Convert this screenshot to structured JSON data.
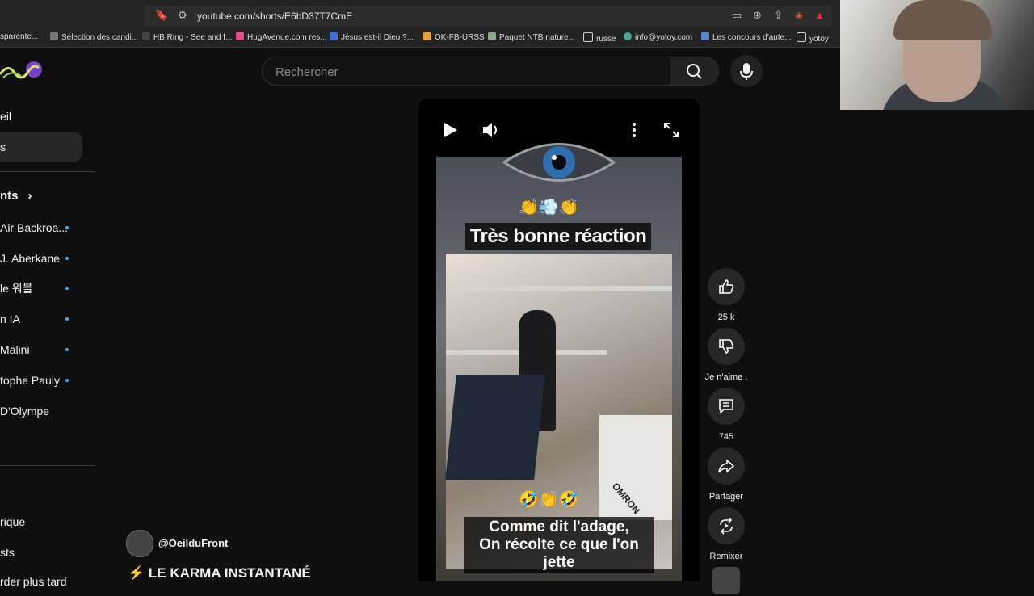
{
  "browser": {
    "url": "youtube.com/shorts/E6bD37T7CmE",
    "bookmarks": [
      "sparente...",
      "Sélection des candi...",
      "HB Ring - See and f...",
      "HugAvenue.com res...",
      "Jésus est-il Dieu ?...",
      "OK-FB-URSS",
      "Paquet NTB nature...",
      "russe",
      "info@yotoy.com",
      "Les concours d'aute...",
      "yotoy"
    ]
  },
  "search": {
    "placeholder": "Rechercher"
  },
  "sidebar": {
    "items": [
      "eil",
      "s"
    ],
    "subs_heading": "nts",
    "subscriptions": [
      "Air Backroa...",
      "J. Aberkane",
      "le 워블",
      "n IA",
      "Malini",
      "tophe Pauly",
      "D'Olympe"
    ],
    "bottom": [
      "rique",
      "sts",
      "rder plus tard"
    ]
  },
  "video": {
    "caption_top": "Très bonne réaction",
    "caption_bottom_line1": "Comme dit l'adage,",
    "caption_bottom_line2": "On récolte ce que l'on jette",
    "emoji_top": "👏💨👏",
    "emoji_bottom": "🤣👏🤣",
    "brand_on_box": "OMRON"
  },
  "actions": {
    "like_count": "25 k",
    "dislike_label": "Je n'aime .",
    "comments_count": "745",
    "share_label": "Partager",
    "remix_label": "Remixer"
  },
  "channel": {
    "handle": "@OeilduFront"
  },
  "title": "⚡ LE KARMA INSTANTANÉ"
}
